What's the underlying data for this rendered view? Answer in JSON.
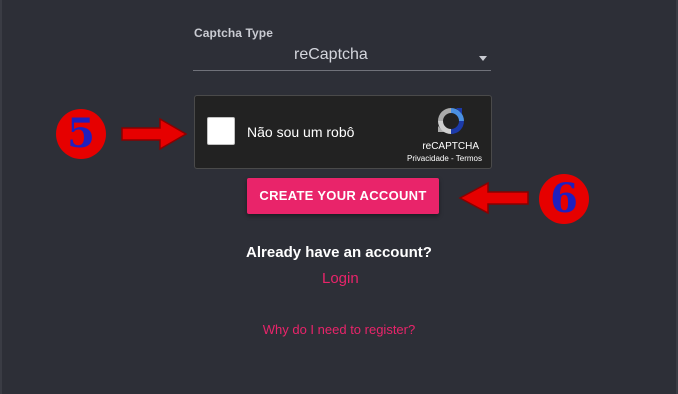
{
  "form": {
    "captcha_type_label": "Captcha Type",
    "captcha_type_value": "reCaptcha",
    "create_button": "CREATE YOUR ACCOUNT",
    "already_text": "Already have an account?",
    "login_link": "Login",
    "why_link": "Why do I need to register?"
  },
  "recaptcha": {
    "checkbox_label": "Não sou um robô",
    "checked": false,
    "brand": "reCAPTCHA",
    "privacy": "Privacidade",
    "separator": " - ",
    "terms": "Termos",
    "icon": "recaptcha-logo-icon"
  },
  "annotations": {
    "step_left": "5",
    "step_right": "6",
    "arrow_left_icon": "arrow-right-icon",
    "arrow_right_icon": "arrow-left-icon"
  },
  "colors": {
    "background": "#2d2f37",
    "accent": "#e9246a",
    "recaptcha_bg": "#222222",
    "annotation_red": "#e60000",
    "annotation_blue": "#1f1fbf"
  }
}
